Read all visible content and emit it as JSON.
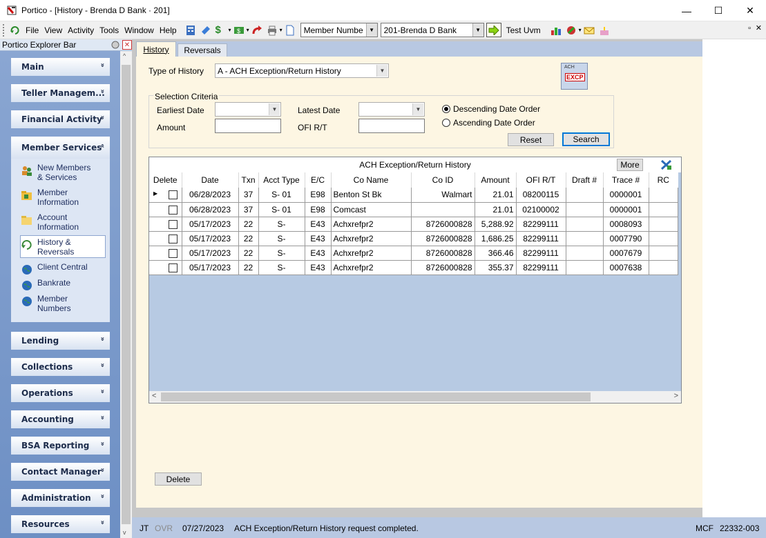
{
  "window": {
    "title": "Portico - [History - Brenda D Bank · 201]",
    "minimize": "—",
    "maximize": "☐",
    "close": "✕"
  },
  "menu": {
    "items": [
      "File",
      "View",
      "Activity",
      "Tools",
      "Window",
      "Help"
    ],
    "search_type": "Member Numbe",
    "member": "201-Brenda D Bank",
    "user": "Test Uvm"
  },
  "explorer": {
    "title": "Portico Explorer Bar",
    "groups": [
      {
        "label": "Main",
        "chev": "»"
      },
      {
        "label": "Teller Managem...",
        "chev": "»"
      },
      {
        "label": "Financial Activity",
        "chev": "»"
      },
      {
        "label": "Member Services",
        "chev": "«"
      },
      {
        "label": "Lending",
        "chev": "»"
      },
      {
        "label": "Collections",
        "chev": "»"
      },
      {
        "label": "Operations",
        "chev": "»"
      },
      {
        "label": "Accounting",
        "chev": "»"
      },
      {
        "label": "BSA Reporting",
        "chev": "»"
      },
      {
        "label": "Contact Manager",
        "chev": "»"
      },
      {
        "label": "Administration",
        "chev": "»"
      },
      {
        "label": "Resources",
        "chev": "»"
      }
    ],
    "member_services_items": [
      {
        "line1": "New Members",
        "line2": "& Services",
        "icon": "people-icon"
      },
      {
        "line1": "Member",
        "line2": "Information",
        "icon": "folder-icon"
      },
      {
        "line1": "Account",
        "line2": "Information",
        "icon": "folder-open-icon"
      },
      {
        "line1": "History &",
        "line2": "Reversals",
        "icon": "history-icon"
      },
      {
        "line1": "Client Central",
        "line2": "",
        "icon": "globe-icon"
      },
      {
        "line1": "Bankrate",
        "line2": "",
        "icon": "globe-icon"
      },
      {
        "line1": "Member",
        "line2": "Numbers",
        "icon": "globe-icon"
      }
    ]
  },
  "tabs": [
    {
      "label": "History"
    },
    {
      "label": "Reversals"
    }
  ],
  "form": {
    "type_of_history_label": "Type of History",
    "type_of_history_value": "A - ACH Exception/Return History",
    "badge_top": "ACH",
    "badge_main": "EXCP",
    "selection_criteria": "Selection Criteria",
    "earliest_date_label": "Earliest Date",
    "latest_date_label": "Latest Date",
    "amount_label": "Amount",
    "ofi_rt_label": "OFI R/T",
    "descending_label": "Descending Date Order",
    "ascending_label": "Ascending Date Order",
    "reset_label": "Reset",
    "search_label": "Search",
    "delete_label": "Delete"
  },
  "grid": {
    "caption": "ACH Exception/Return History",
    "more_label": "More",
    "columns": [
      "Delete",
      "Date",
      "Txn",
      "Acct Type",
      "E/C",
      "Co Name",
      "Co ID",
      "Amount",
      "OFI R/T",
      "Draft #",
      "Trace #",
      "RC"
    ],
    "rows": [
      {
        "date": "06/28/2023",
        "txn": "37",
        "acct_type": "S-  01",
        "ec": "E98",
        "co_name": "Benton St Bk",
        "co_id": "Walmart",
        "amount": "21.01",
        "ofi_rt": "08200115",
        "draft": "",
        "trace": "0000001",
        "rc": ""
      },
      {
        "date": "06/28/2023",
        "txn": "37",
        "acct_type": "S-  01",
        "ec": "E98",
        "co_name": "Comcast",
        "co_id": "",
        "amount": "21.01",
        "ofi_rt": "02100002",
        "draft": "",
        "trace": "0000001",
        "rc": ""
      },
      {
        "date": "05/17/2023",
        "txn": "22",
        "acct_type": "S-",
        "ec": "E43",
        "co_name": "Achxrefpr2",
        "co_id": "8726000828",
        "amount": "5,288.92",
        "ofi_rt": "82299111",
        "draft": "",
        "trace": "0008093",
        "rc": ""
      },
      {
        "date": "05/17/2023",
        "txn": "22",
        "acct_type": "S-",
        "ec": "E43",
        "co_name": "Achxrefpr2",
        "co_id": "8726000828",
        "amount": "1,686.25",
        "ofi_rt": "82299111",
        "draft": "",
        "trace": "0007790",
        "rc": ""
      },
      {
        "date": "05/17/2023",
        "txn": "22",
        "acct_type": "S-",
        "ec": "E43",
        "co_name": "Achxrefpr2",
        "co_id": "8726000828",
        "amount": "366.46",
        "ofi_rt": "82299111",
        "draft": "",
        "trace": "0007679",
        "rc": ""
      },
      {
        "date": "05/17/2023",
        "txn": "22",
        "acct_type": "S-",
        "ec": "E43",
        "co_name": "Achxrefpr2",
        "co_id": "8726000828",
        "amount": "355.37",
        "ofi_rt": "82299111",
        "draft": "",
        "trace": "0007638",
        "rc": ""
      }
    ]
  },
  "status": {
    "user": "JT",
    "ovr": "OVR",
    "date": "07/27/2023",
    "message": "ACH Exception/Return History request completed.",
    "mcf": "MCF",
    "code": "22332-003"
  },
  "colors": {
    "panel_bg": "#fdf6e3",
    "explorer_blue": "#6f92c6",
    "status_blue": "#b8c8e2",
    "grid_empty": "#b7cae3"
  }
}
